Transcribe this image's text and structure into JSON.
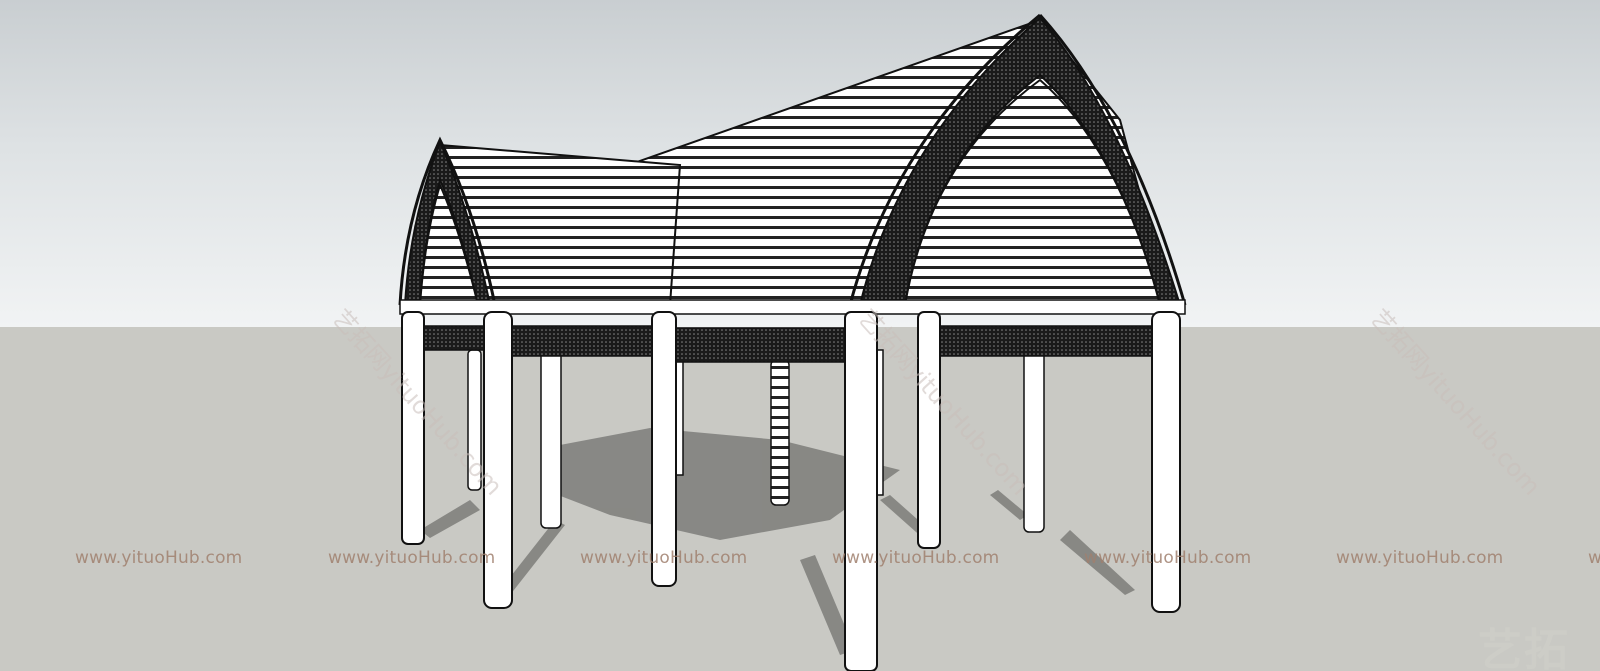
{
  "scene": {
    "subject": "pavilion-3d-model",
    "colors": {
      "sky_top": "#c9ced1",
      "sky_bottom": "#f1f3f4",
      "ground": "#c9c9c4",
      "outline": "#111111",
      "shadow": "#7d7d7a"
    }
  },
  "watermark": {
    "url_text": "www.yituoHub.com",
    "url_partial": "w",
    "diagonal_text": "艺拓网yituoHub.com",
    "logo_text": "艺拓"
  }
}
